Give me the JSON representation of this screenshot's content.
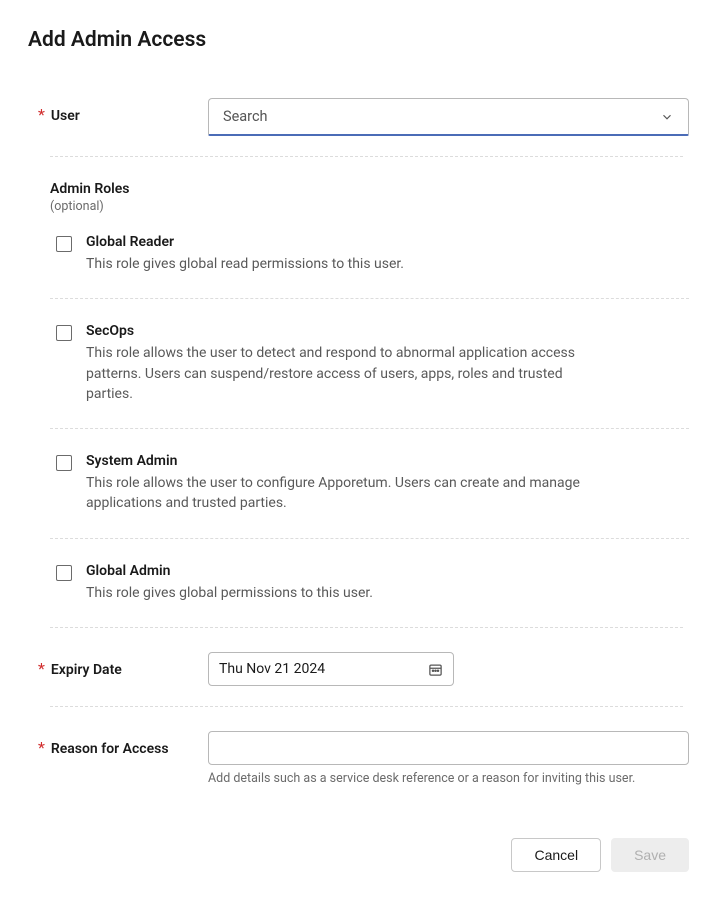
{
  "title": "Add Admin Access",
  "user_field": {
    "label": "User",
    "placeholder": "Search"
  },
  "roles_section": {
    "title": "Admin Roles",
    "optional": "(optional)",
    "roles": [
      {
        "name": "Global Reader",
        "description": "This role gives global read permissions to this user."
      },
      {
        "name": "SecOps",
        "description": "This role allows the user to detect and respond to abnormal application access patterns. Users can suspend/restore access of users, apps, roles and trusted parties."
      },
      {
        "name": "System Admin",
        "description": "This role allows the user to configure Apporetum. Users can create and manage applications and trusted parties."
      },
      {
        "name": "Global Admin",
        "description": "This role gives global permissions to this user."
      }
    ]
  },
  "expiry_field": {
    "label": "Expiry Date",
    "value": "Thu Nov 21 2024"
  },
  "reason_field": {
    "label": "Reason for Access",
    "helper": "Add details such as a service desk reference or a reason for inviting this user."
  },
  "buttons": {
    "cancel": "Cancel",
    "save": "Save"
  }
}
